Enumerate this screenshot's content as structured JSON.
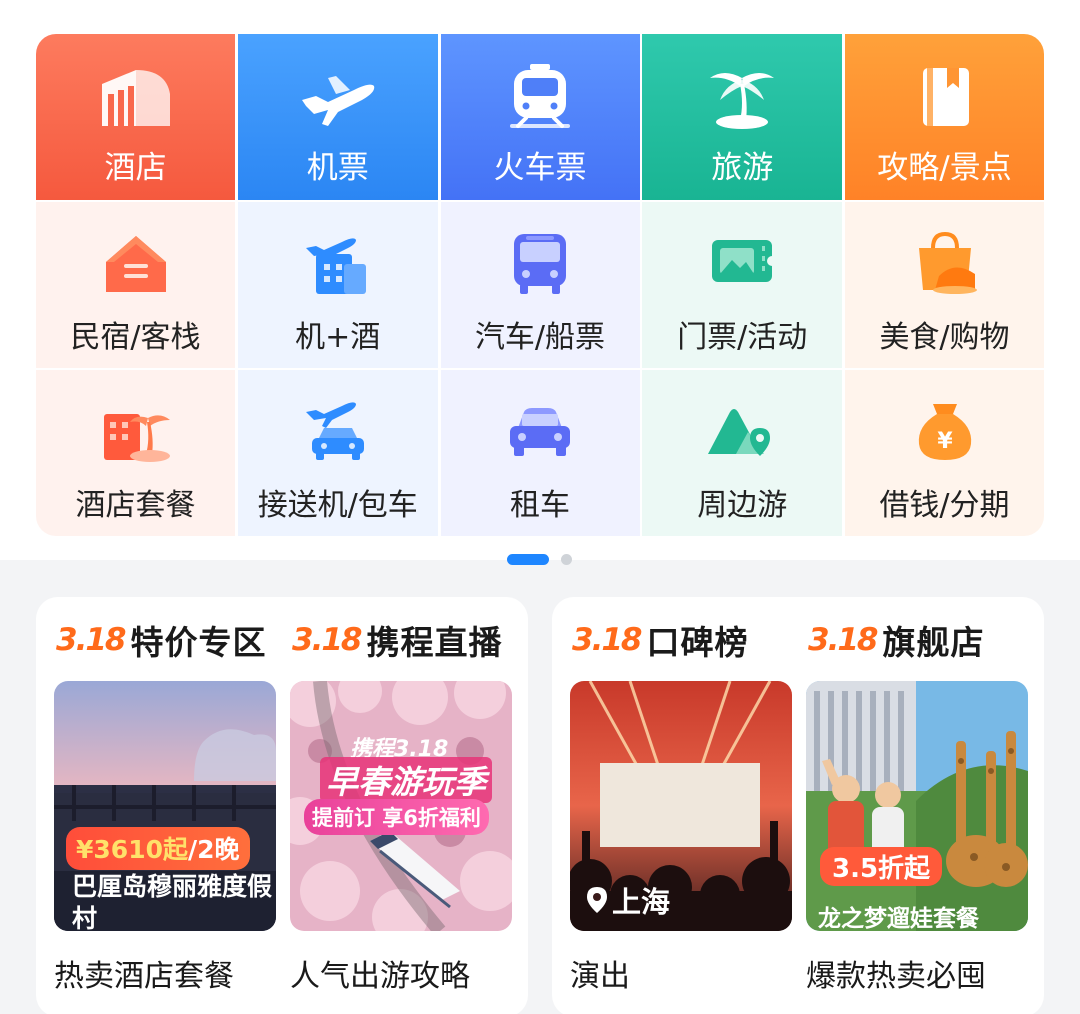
{
  "grid": {
    "row1": [
      {
        "label": "酒店",
        "icon": "hotel-building-icon"
      },
      {
        "label": "机票",
        "icon": "airplane-icon"
      },
      {
        "label": "火车票",
        "icon": "train-icon"
      },
      {
        "label": "旅游",
        "icon": "palm-tree-icon"
      },
      {
        "label": "攻略/景点",
        "icon": "guidebook-icon"
      }
    ],
    "row2": [
      {
        "label": "民宿/客栈",
        "icon": "house-icon"
      },
      {
        "label": "机+酒",
        "icon": "flight-hotel-icon"
      },
      {
        "label": "汽车/船票",
        "icon": "bus-icon"
      },
      {
        "label": "门票/活动",
        "icon": "ticket-icon"
      },
      {
        "label": "美食/购物",
        "icon": "shopping-bag-icon"
      }
    ],
    "row3": [
      {
        "label": "酒店套餐",
        "icon": "hotel-package-icon"
      },
      {
        "label": "接送机/包车",
        "icon": "airport-car-icon"
      },
      {
        "label": "租车",
        "icon": "car-icon"
      },
      {
        "label": "周边游",
        "icon": "mountain-pin-icon"
      },
      {
        "label": "借钱/分期",
        "icon": "money-bag-icon"
      }
    ]
  },
  "pager": {
    "pages": 2,
    "active": 1
  },
  "promos": [
    {
      "badge": "3.18",
      "title": "特价专区",
      "caption": "热卖酒店套餐",
      "image": {
        "price_prefix": "¥",
        "price": "3610起",
        "price_suffix": "/2晚",
        "name": "巴厘岛穆丽雅度假村"
      }
    },
    {
      "badge": "3.18",
      "title": "携程直播",
      "caption": "人气出游攻略",
      "image": {
        "brand": "携程3.18",
        "headline": "早春游玩季",
        "subline": "提前订 享6折福利"
      }
    },
    {
      "badge": "3.18",
      "title": "口碑榜",
      "caption": "演出",
      "image": {
        "location": "上海"
      }
    },
    {
      "badge": "3.18",
      "title": "旗舰店",
      "caption": "爆款热卖必囤",
      "image": {
        "discount": "3.5折起",
        "package": "龙之梦遛娃套餐"
      }
    }
  ],
  "colors": {
    "hotel": "#f5593e",
    "flight": "#2b86f3",
    "train": "#4472f6",
    "travel": "#19b493",
    "guide": "#ff8227",
    "accent": "#1e86ff",
    "badge": "#ff6a1a"
  }
}
